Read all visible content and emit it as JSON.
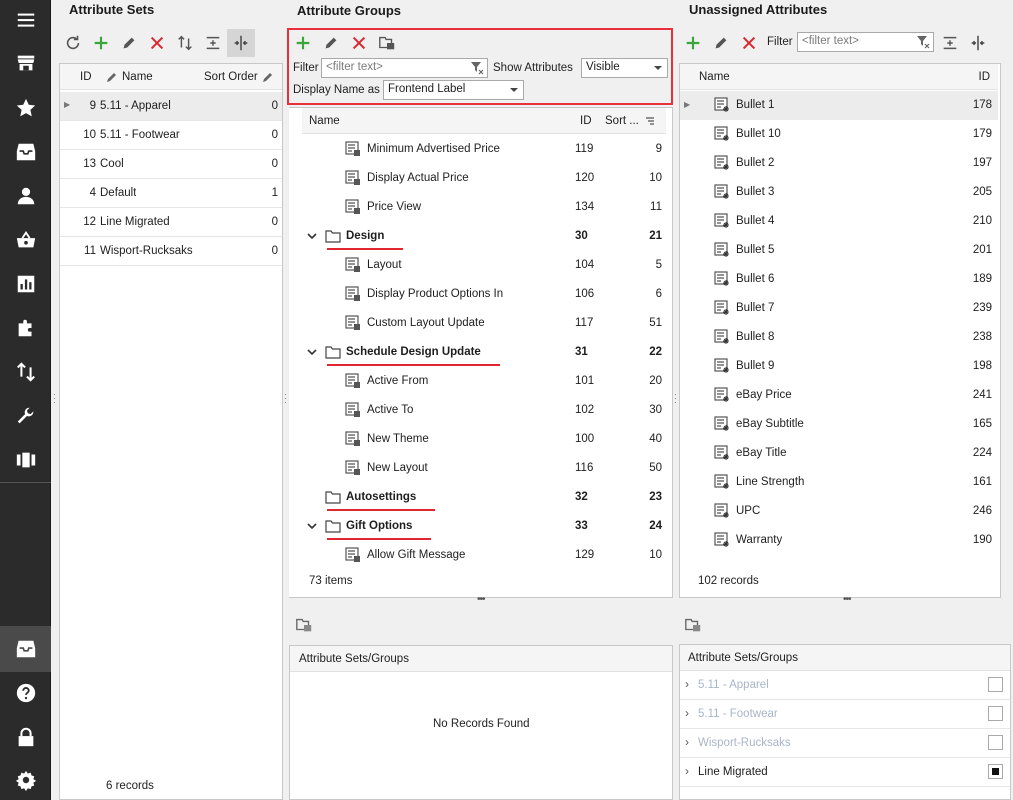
{
  "sidebar": {
    "icons": [
      "menu-icon",
      "store-icon",
      "star-icon",
      "inbox-icon",
      "user-icon",
      "basket-icon",
      "chart-icon",
      "puzzle-icon",
      "sort-arrows-icon",
      "wrench-icon",
      "columns-icon",
      "inbox-icon",
      "help-icon",
      "lock-icon",
      "gear-icon"
    ]
  },
  "attribute_sets": {
    "title": "Attribute Sets",
    "columns": {
      "id": "ID",
      "name": "Name",
      "sort_order": "Sort Order"
    },
    "rows": [
      {
        "id": "9",
        "name": "5.11 - Apparel",
        "sort": "0"
      },
      {
        "id": "10",
        "name": "5.11 - Footwear",
        "sort": "0"
      },
      {
        "id": "13",
        "name": "Cool",
        "sort": "0"
      },
      {
        "id": "4",
        "name": "Default",
        "sort": "1"
      },
      {
        "id": "12",
        "name": "Line Migrated",
        "sort": "0"
      },
      {
        "id": "11",
        "name": "Wisport-Rucksaks",
        "sort": "0"
      }
    ],
    "footer": "6 records"
  },
  "attribute_groups": {
    "title": "Attribute Groups",
    "filter_label": "Filter",
    "filter_placeholder": "<filter text>",
    "show_attributes_label": "Show Attributes",
    "show_attributes_value": "Visible",
    "display_name_label": "Display Name as",
    "display_name_value": "Frontend Label",
    "columns": {
      "name": "Name",
      "id": "ID",
      "sort": "Sort ..."
    },
    "rows": [
      {
        "name": "Minimum Advertised Price",
        "id": "119",
        "sort": "9"
      },
      {
        "name": "Display Actual Price",
        "id": "120",
        "sort": "10"
      },
      {
        "name": "Price View",
        "id": "134",
        "sort": "11"
      },
      {
        "name": "Design",
        "id": "30",
        "sort": "21"
      },
      {
        "name": "Layout",
        "id": "104",
        "sort": "5"
      },
      {
        "name": "Display Product Options In",
        "id": "106",
        "sort": "6"
      },
      {
        "name": "Custom Layout Update",
        "id": "117",
        "sort": "51"
      },
      {
        "name": "Schedule Design Update",
        "id": "31",
        "sort": "22"
      },
      {
        "name": "Active From",
        "id": "101",
        "sort": "20"
      },
      {
        "name": "Active To",
        "id": "102",
        "sort": "30"
      },
      {
        "name": "New Theme",
        "id": "100",
        "sort": "40"
      },
      {
        "name": "New Layout",
        "id": "116",
        "sort": "50"
      },
      {
        "name": "Autosettings",
        "id": "32",
        "sort": "23"
      },
      {
        "name": "Gift Options",
        "id": "33",
        "sort": "24"
      },
      {
        "name": "Allow Gift Message",
        "id": "129",
        "sort": "10"
      }
    ],
    "footer": "73 items",
    "sets_groups_header": "Attribute Sets/Groups",
    "no_records": "No Records Found"
  },
  "unassigned": {
    "title": "Unassigned Attributes",
    "filter_label": "Filter",
    "filter_placeholder": "<filter text>",
    "columns": {
      "name": "Name",
      "id": "ID"
    },
    "rows": [
      {
        "name": "Bullet 1",
        "id": "178"
      },
      {
        "name": "Bullet 10",
        "id": "179"
      },
      {
        "name": "Bullet 2",
        "id": "197"
      },
      {
        "name": "Bullet 3",
        "id": "205"
      },
      {
        "name": "Bullet 4",
        "id": "210"
      },
      {
        "name": "Bullet 5",
        "id": "201"
      },
      {
        "name": "Bullet 6",
        "id": "189"
      },
      {
        "name": "Bullet 7",
        "id": "239"
      },
      {
        "name": "Bullet 8",
        "id": "238"
      },
      {
        "name": "Bullet 9",
        "id": "198"
      },
      {
        "name": "eBay Price",
        "id": "241"
      },
      {
        "name": "eBay Subtitle",
        "id": "165"
      },
      {
        "name": "eBay Title",
        "id": "224"
      },
      {
        "name": "Line Strength",
        "id": "161"
      },
      {
        "name": "UPC",
        "id": "246"
      },
      {
        "name": "Warranty",
        "id": "190"
      }
    ],
    "footer": "102 records",
    "sets_groups_header": "Attribute Sets/Groups",
    "sets_groups_rows": [
      {
        "name": "5.11 - Apparel",
        "dim": true,
        "checked": false
      },
      {
        "name": "5.11 - Footwear",
        "dim": true,
        "checked": false
      },
      {
        "name": "Wisport-Rucksaks",
        "dim": true,
        "checked": false
      },
      {
        "name": "Line Migrated",
        "dim": false,
        "checked": true
      }
    ]
  },
  "colors": {
    "accent_red": "#e8303a",
    "add_green": "#3aa53a",
    "delete_red": "#d9262f",
    "sidebar": "#2b2b2b"
  }
}
